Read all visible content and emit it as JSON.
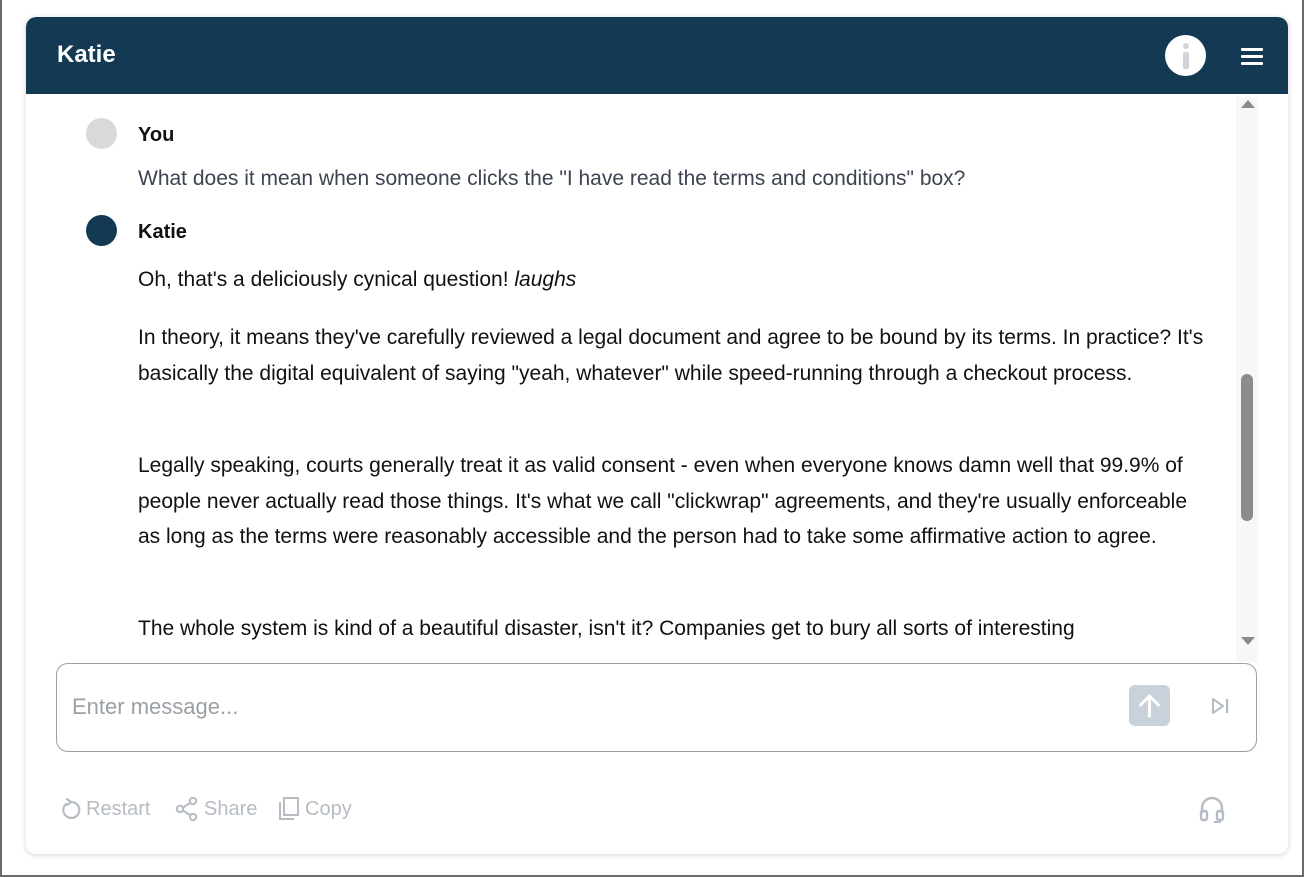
{
  "header": {
    "title": "Katie",
    "accent_color": "#133a52"
  },
  "conversation": {
    "user": {
      "name": "You",
      "message": "What does it mean when someone clicks the \"I have read the terms and conditions\" box?"
    },
    "bot": {
      "name": "Katie",
      "p1_text": "Oh, that's a deliciously cynical question! ",
      "p1_emphasis": "laughs",
      "p2": "In theory, it means they've carefully reviewed a legal document and agree to be bound by its terms. In practice? It's basically the digital equivalent of saying \"yeah, whatever\" while speed-running through a checkout process.",
      "p3": "Legally speaking, courts generally treat it as valid consent - even when everyone knows damn well that 99.9% of people never actually read those things. It's what we call \"clickwrap\" agreements, and they're usually enforceable as long as the terms were reasonably accessible and the person had to take some affirmative action to agree.",
      "p4": "The whole system is kind of a beautiful disaster, isn't it? Companies get to bury all sorts of interesting"
    }
  },
  "composer": {
    "placeholder": "Enter message..."
  },
  "footer": {
    "restart_label": "Restart",
    "share_label": "Share",
    "copy_label": "Copy"
  }
}
